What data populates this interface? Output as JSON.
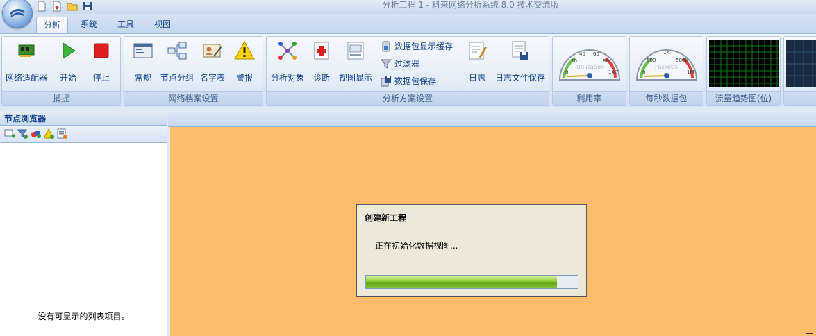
{
  "window": {
    "title": "分析工程 1 - 科来网络分析系统 8.0 技术交流版"
  },
  "tabs": [
    "分析",
    "系统",
    "工具",
    "视图"
  ],
  "ribbon": {
    "capture": {
      "label": "捕捉",
      "adapter": "网络适配器",
      "start": "开始",
      "stop": "停止"
    },
    "profile": {
      "label": "网络档案设置",
      "general": "常规",
      "node_group": "节点分组",
      "name_table": "名字表",
      "alarm": "警报"
    },
    "analysis": {
      "label": "分析方案设置",
      "objects": "分析对象",
      "diagnose": "诊断",
      "view_display": "视图显示",
      "packet_buffer": "数据包显示缓存",
      "filter": "过滤器",
      "packet_save": "数据包保存",
      "log": "日志",
      "log_save": "日志文件保存"
    },
    "utilization": {
      "label": "利用率",
      "gauge_name": "Utilization",
      "ticks": [
        "0",
        "20",
        "40",
        "60",
        "80",
        "100"
      ]
    },
    "packets_per_sec": {
      "label": "每秒数据包",
      "gauge_name": "Packet/s",
      "ticks": [
        "0",
        "500",
        "1K",
        "500K",
        "1M"
      ]
    },
    "traffic_trend": {
      "label": "流量趋势图(位)"
    }
  },
  "node_browser": {
    "title": "节点浏览器",
    "empty_text": "没有可显示的列表项目。"
  },
  "dialog": {
    "title": "创建新工程",
    "message": "正在初始化数据视图...",
    "progress": 0.9
  }
}
